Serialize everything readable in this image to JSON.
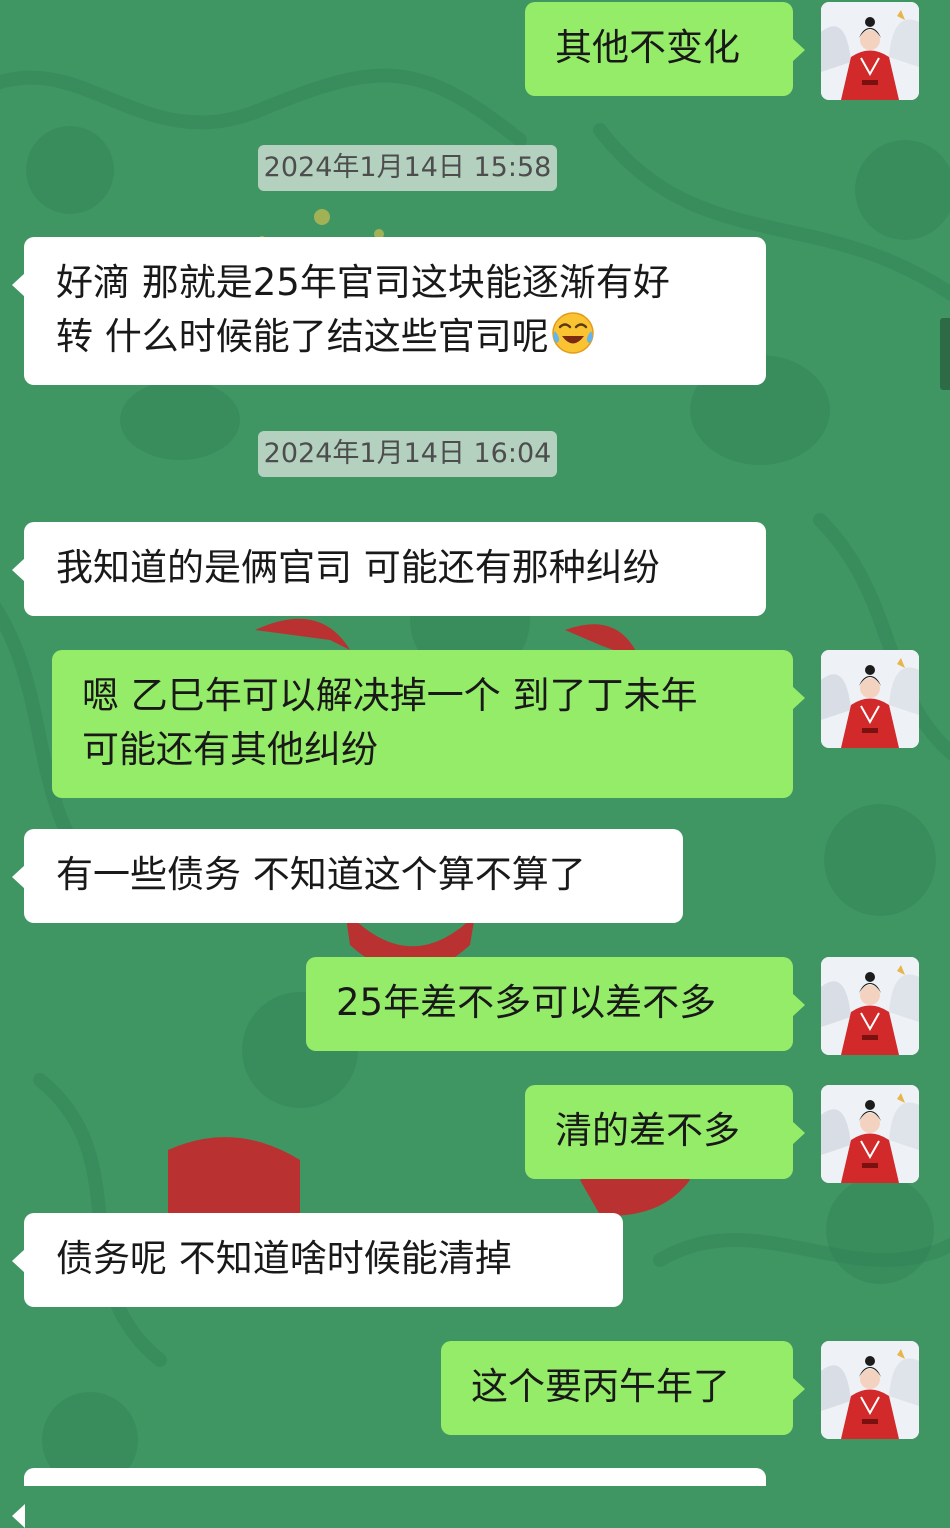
{
  "colors": {
    "background": "#3f9663",
    "incoming_bubble": "#ffffff",
    "outgoing_bubble": "#95ec69",
    "timestamp_bg": "#e2e8e4",
    "text": "#191919"
  },
  "messages": [
    {
      "type": "outgoing",
      "text": "其他不变化",
      "avatar": "avatar-woman-red-hanfu-icon"
    },
    {
      "type": "timestamp",
      "text": "2024年1月14日 15:58"
    },
    {
      "type": "incoming",
      "lines": [
        "好滴 那就是25年官司这块能逐渐有好",
        "转 什么时候能了结这些官司呢"
      ],
      "emoji": "crying-laughing-emoji-icon"
    },
    {
      "type": "timestamp",
      "text": "2024年1月14日 16:04"
    },
    {
      "type": "incoming",
      "text": "我知道的是俩官司  可能还有那种纠纷"
    },
    {
      "type": "outgoing",
      "lines": [
        "嗯 乙巳年可以解决掉一个 到了丁未年",
        "可能还有其他纠纷"
      ],
      "avatar": "avatar-woman-red-hanfu-icon"
    },
    {
      "type": "incoming",
      "text": "有一些债务 不知道这个算不算了"
    },
    {
      "type": "outgoing",
      "text": "25年差不多可以差不多",
      "avatar": "avatar-woman-red-hanfu-icon"
    },
    {
      "type": "outgoing",
      "text": "清的差不多",
      "avatar": "avatar-woman-red-hanfu-icon"
    },
    {
      "type": "incoming",
      "text": "债务呢 不知道啥时候能清掉"
    },
    {
      "type": "outgoing",
      "text": "这个要丙午年了",
      "avatar": "avatar-woman-red-hanfu-icon"
    }
  ]
}
